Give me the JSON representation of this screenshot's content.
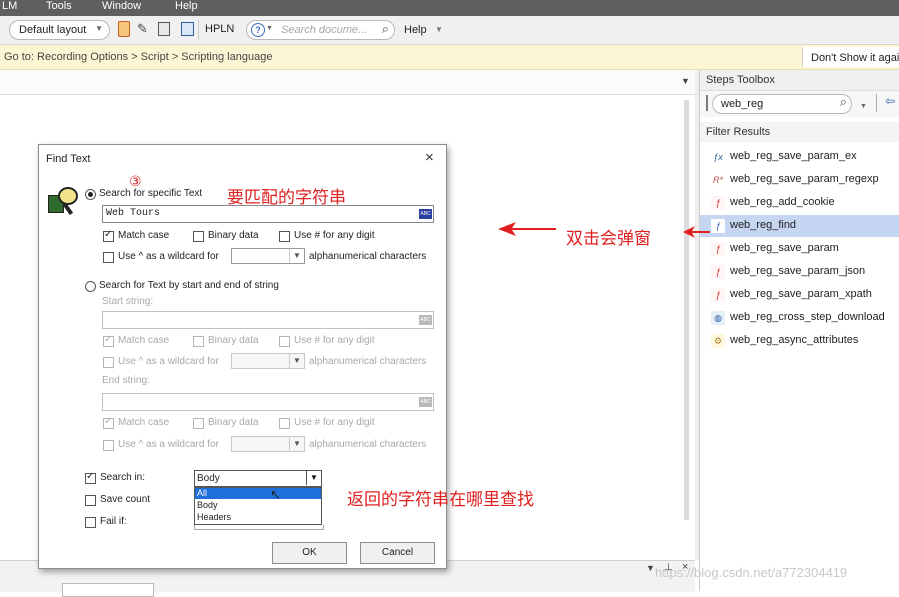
{
  "menubar": {
    "items": [
      "LM",
      "Tools",
      "Window",
      "Help"
    ]
  },
  "toolbar": {
    "layout_value": "Default layout",
    "hpln_label": "HPLN",
    "search_placeholder": "Search docume...",
    "help_label": "Help"
  },
  "banner": {
    "breadcrumb": "Go to: Recording Options > Script > Scripting language",
    "dont_show": "Don't Show it again"
  },
  "toolbox": {
    "title": "Steps Toolbox",
    "search_value": "web_reg",
    "filter_label": "Filter Results",
    "items": [
      {
        "label": "web_reg_save_param_ex",
        "icon": "fx-icon"
      },
      {
        "label": "web_reg_save_param_regexp",
        "icon": "regexp-icon"
      },
      {
        "label": "web_reg_add_cookie",
        "icon": "fx-red-icon"
      },
      {
        "label": "web_reg_find",
        "icon": "fx-blue-icon"
      },
      {
        "label": "web_reg_save_param",
        "icon": "fx-red-icon"
      },
      {
        "label": "web_reg_save_param_json",
        "icon": "fx-red-icon"
      },
      {
        "label": "web_reg_save_param_xpath",
        "icon": "fx-red-icon"
      },
      {
        "label": "web_reg_cross_step_download",
        "icon": "globe-icon"
      },
      {
        "label": "web_reg_async_attributes",
        "icon": "async-icon"
      }
    ],
    "selected_index": 3,
    "selected_color": "#c5d5f2"
  },
  "dialog": {
    "title": "Find Text",
    "step_marker": "③",
    "section1": {
      "radio_label": "Search for specific Text",
      "text_value": "Web Tours",
      "match_case": "Match case",
      "binary_data": "Binary data",
      "use_hash": "Use # for any digit",
      "use_caret": "Use ^ as a wildcard for",
      "alnum": "alphanumerical characters"
    },
    "section2": {
      "radio_label": "Search for Text by start and end of string",
      "start_label": "Start string:",
      "end_label": "End string:",
      "match_case": "Match case",
      "binary_data": "Binary data",
      "use_hash": "Use # for any digit",
      "use_caret": "Use ^ as a wildcard for",
      "alnum": "alphanumerical characters"
    },
    "search_in_label": "Search in:",
    "search_in_value": "Body",
    "search_in_options": [
      "All",
      "Body",
      "Headers"
    ],
    "save_count_label": "Save count",
    "fail_if_label": "Fail if:",
    "ok_label": "OK",
    "cancel_label": "Cancel"
  },
  "annotations": {
    "match_string": "要匹配的字符串",
    "double_click": "双击会弹窗",
    "where_search": "返回的字符串在哪里查找"
  },
  "watermark": "https://blog.csdn.net/a772304419",
  "colors": {
    "annotation": "#e02020",
    "accent_blue": "#2b3fa0"
  }
}
